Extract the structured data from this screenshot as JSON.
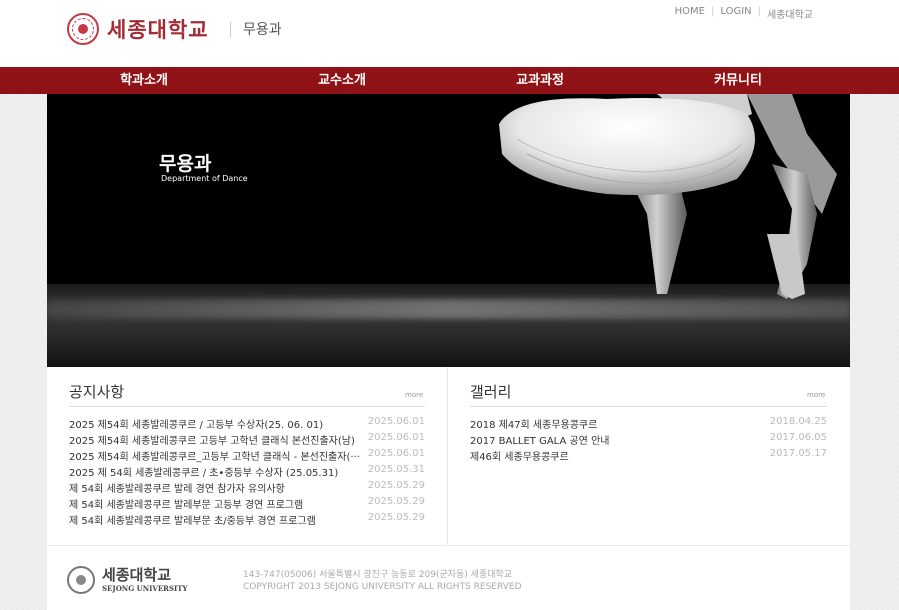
{
  "header": {
    "logo_text": "세종대학교",
    "dept": "무용과",
    "util": [
      "HOME",
      "LOGIN",
      "세종대학교"
    ]
  },
  "nav": [
    "학과소개",
    "교수소개",
    "교과과정",
    "커뮤니티"
  ],
  "hero": {
    "title": "무용과",
    "subtitle": "Department of Dance"
  },
  "notice": {
    "title": "공지사항",
    "more": "more",
    "items": [
      {
        "title": "2025 제54회 세종발레콩쿠르 / 고등부 수상자(25. 06. 01)",
        "date": "2025.06.01"
      },
      {
        "title": "2025 제54회 세종발레콩쿠르 고등부 고학년 클래식 본선진출자(남)",
        "date": "2025.06.01"
      },
      {
        "title": "2025 제54회 세종발레콩쿠르_고등부 고학년 클래식 - 본선진출자(···",
        "date": "2025.06.01"
      },
      {
        "title": "2025 제 54회 세종발레콩쿠르 / 초•중등부 수상자 (25.05.31)",
        "date": "2025.05.31"
      },
      {
        "title": "제 54회 세종발레콩쿠르 발레 경연 참가자 유의사항",
        "date": "2025.05.29"
      },
      {
        "title": "제 54회 세종발레콩쿠르 발레부문 고등부 경연 프로그램",
        "date": "2025.05.29"
      },
      {
        "title": "제 54회 세종발레콩쿠르 발레부문 초/중등부 경연 프로그램",
        "date": "2025.05.29"
      }
    ]
  },
  "gallery": {
    "title": "갤러리",
    "more": "more",
    "items": [
      {
        "title": "2018 제47회 세종무용콩쿠르",
        "date": "2018.04.25"
      },
      {
        "title": "2017 BALLET GALA 공연 안내",
        "date": "2017.06.05"
      },
      {
        "title": "제46회 세종무용콩쿠르",
        "date": "2017.05.17"
      }
    ]
  },
  "footer": {
    "name": "세종대학교",
    "eng": "SEJONG UNIVERSITY",
    "address": "143-747(05006) 서울특별시 광진구 능동로 209(군자동) 세종대학교",
    "copyright": "COPYRIGHT 2013 SEJONG UNIVERSITY ALL RIGHTS RESERVED"
  },
  "colors": {
    "brand": "#8e1216",
    "logo": "#a32b35"
  }
}
